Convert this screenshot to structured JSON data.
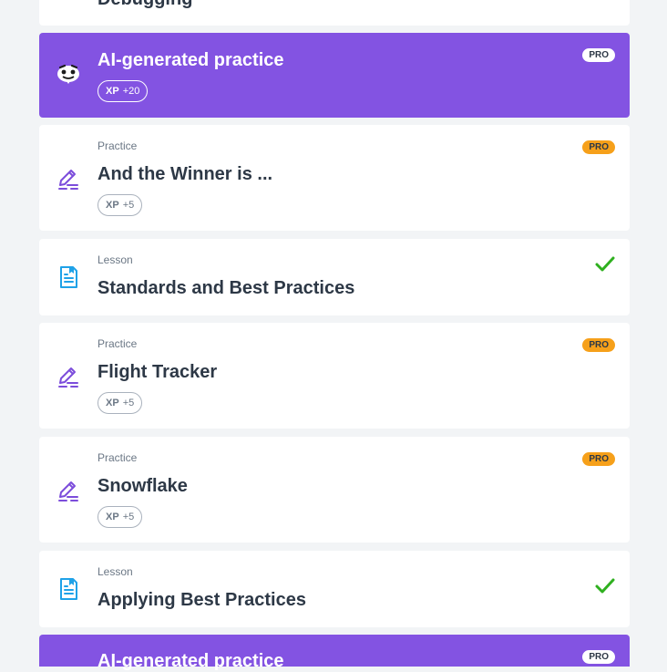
{
  "cards": [
    {
      "type": "lesson-partial",
      "title": "Debugging"
    },
    {
      "type": "ai",
      "title": "AI-generated practice",
      "xp_label": "XP",
      "xp_value": "+20",
      "badge": "PRO"
    },
    {
      "type": "practice",
      "kind": "Practice",
      "title": "And the Winner is ...",
      "xp_label": "XP",
      "xp_value": "+5",
      "badge": "PRO"
    },
    {
      "type": "lesson",
      "kind": "Lesson",
      "title": "Standards and Best Practices",
      "status": "completed"
    },
    {
      "type": "practice",
      "kind": "Practice",
      "title": "Flight Tracker",
      "xp_label": "XP",
      "xp_value": "+5",
      "badge": "PRO"
    },
    {
      "type": "practice",
      "kind": "Practice",
      "title": "Snowflake",
      "xp_label": "XP",
      "xp_value": "+5",
      "badge": "PRO"
    },
    {
      "type": "lesson",
      "kind": "Lesson",
      "title": "Applying Best Practices",
      "status": "completed"
    },
    {
      "type": "ai",
      "title": "AI-generated practice",
      "badge": "PRO"
    }
  ],
  "icons": {
    "ai": "ai-mascot-icon",
    "practice": "pencil-icon",
    "lesson": "document-icon",
    "completed": "checkmark-icon"
  },
  "colors": {
    "ai_card": "#8353e2",
    "pro_badge": "#f6a01a",
    "practice_icon": "#7c4ddb",
    "lesson_icon": "#1fa2e8",
    "check": "#2fb01f",
    "background": "#f2f4f6"
  }
}
